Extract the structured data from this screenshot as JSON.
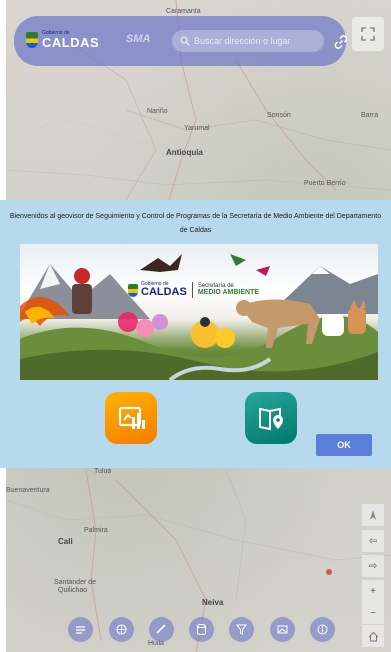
{
  "header": {
    "logo_small": "Gobierno de",
    "logo_name": "CALDAS",
    "app_short": "SMA",
    "search_placeholder": "Buscar dirección o lugar"
  },
  "map_labels": {
    "caramanta": "Caramanta",
    "nariño": "Nariño",
    "sonsón": "Sonsón",
    "yarumal": "Yarumal",
    "antioquia": "Antioquia",
    "puerto_berrio": "Puerto Berrío",
    "barra": "Barra",
    "tulua": "Tuluá",
    "buenaventura": "Buenaventura",
    "palmira": "Palmira",
    "cali": "Cali",
    "santander": "Santander de",
    "quilichao": "Quilichao",
    "neiva": "Neiva",
    "huila": "Huila"
  },
  "modal": {
    "title": "Bienvenidos al geovisor de Seguimiento y Control de Programas de la Secretaría de Medio Ambiente del Departamento de Caldas",
    "banner": {
      "logo_small": "Gobierno de",
      "logo_name": "CALDAS",
      "secretaria": "Secretaría de",
      "medio_ambiente": "MEDIO AMBIENTE"
    },
    "ok_label": "OK"
  },
  "colors": {
    "header": "#6e78c8",
    "modal_bg": "#b6d9ed",
    "ok_button": "#5b7fd8",
    "dashboard_icon": "#f57c00",
    "story_icon": "#00796b"
  }
}
